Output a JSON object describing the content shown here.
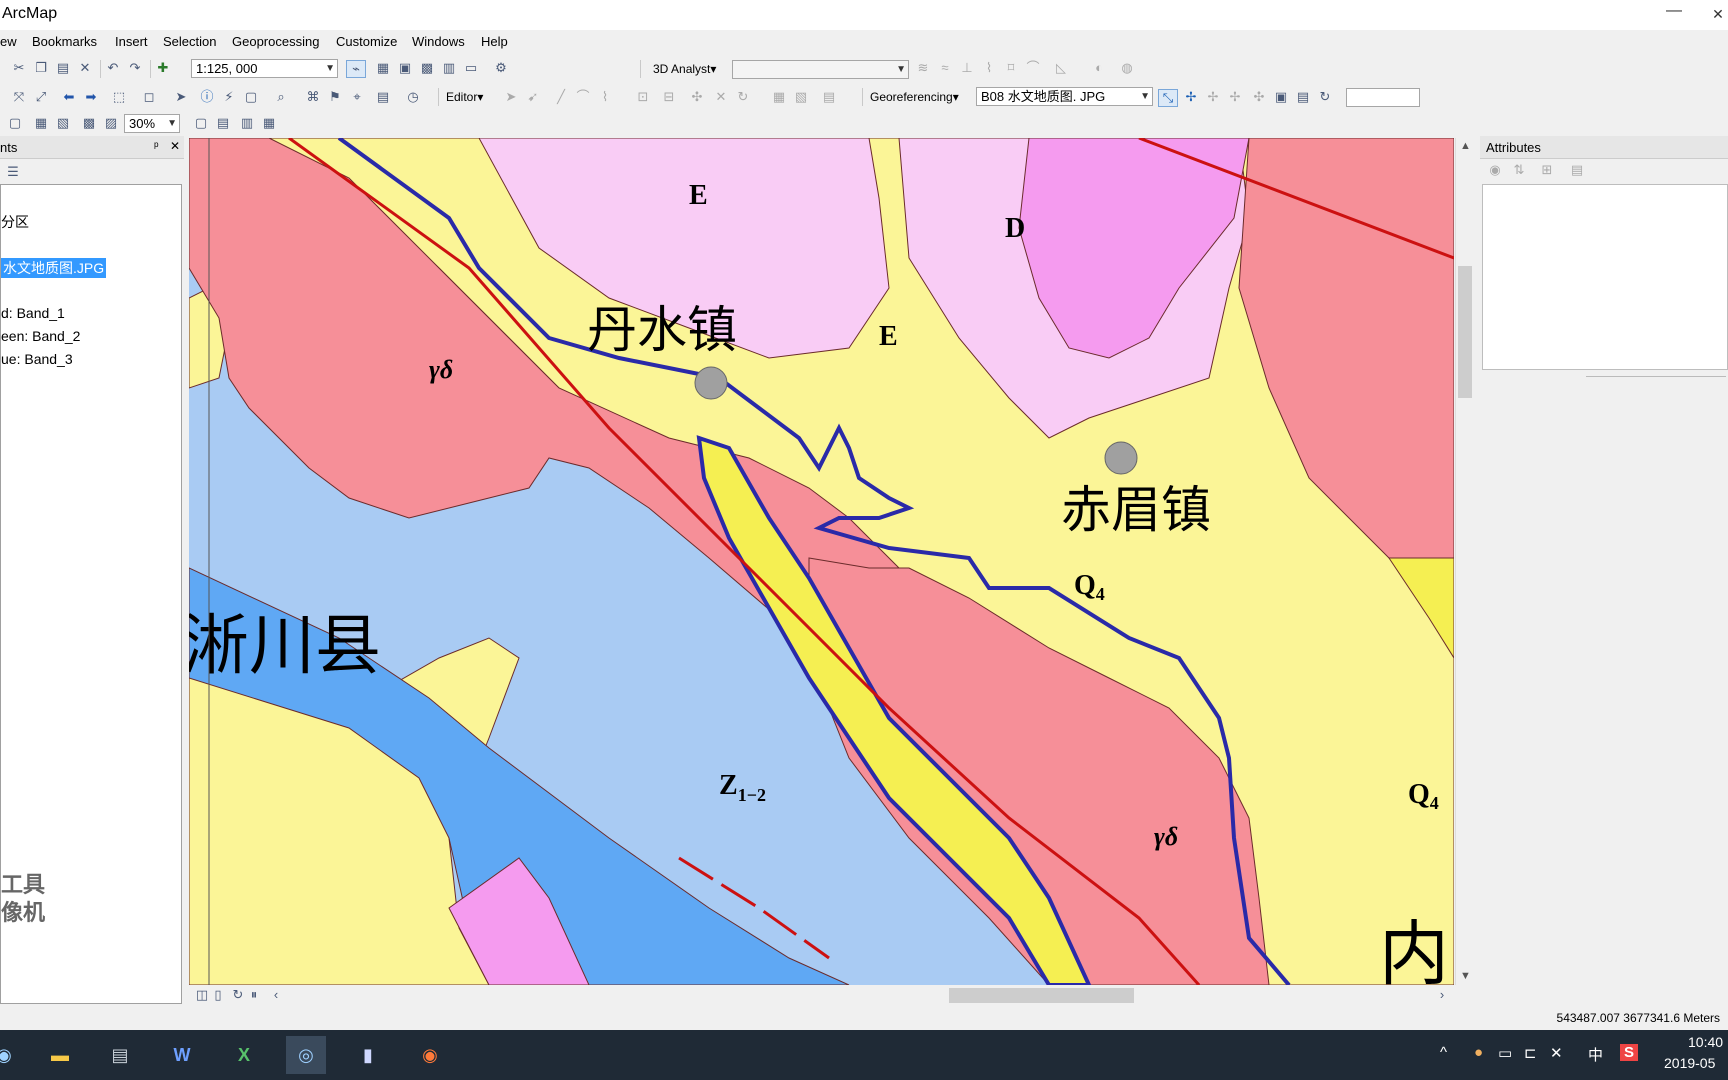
{
  "window": {
    "title": "ArcMap",
    "minimize": "—",
    "close": "✕"
  },
  "menu": [
    "ew",
    "Bookmarks",
    "Insert",
    "Selection",
    "Geoprocessing",
    "Customize",
    "Windows",
    "Help"
  ],
  "toolbar": {
    "scale": "1:125, 000",
    "analyst_label": "3D Analyst▾",
    "editor_label": "Editor▾",
    "georef_label": "Georeferencing▾",
    "georef_layer": "B08 水文地质图. JPG",
    "zoom_percent": "30%"
  },
  "toc": {
    "title": "nts",
    "pin": "ᵖ",
    "close": "✕",
    "items": [
      "分区",
      "水文地质图.JPG",
      "d:    Band_1",
      "een: Band_2",
      "ue:   Band_3"
    ],
    "watermark_1": "工具",
    "watermark_2": "像机"
  },
  "map_labels": {
    "e1": "E",
    "e2": "E",
    "d": "D",
    "town1": "丹水镇",
    "town2": "赤眉镇",
    "county": "淅川县",
    "gd1": "γδ",
    "gd2": "γδ",
    "q1": "Q",
    "q1_sub": "4",
    "q2": "Q",
    "q2_sub": "4",
    "z": "Z",
    "z_sub": "1−2",
    "nei": "内"
  },
  "attributes": {
    "title": "Attributes"
  },
  "status": {
    "coordinates": "543487.007  3677341.6 Meters"
  },
  "taskbar": {
    "time": "10:40",
    "date": "2019-05",
    "ime": "中",
    "sogou": "S"
  }
}
